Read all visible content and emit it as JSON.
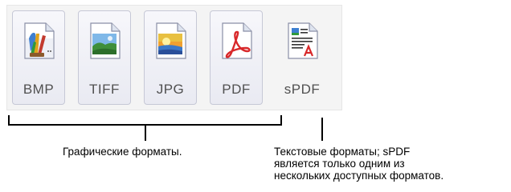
{
  "formats": [
    {
      "label": "BMP",
      "icon": "bmp-file-icon"
    },
    {
      "label": "TIFF",
      "icon": "tiff-file-icon"
    },
    {
      "label": "JPG",
      "icon": "jpg-file-icon"
    },
    {
      "label": "PDF",
      "icon": "pdf-file-icon"
    },
    {
      "label": "sPDF",
      "icon": "spdf-file-icon"
    }
  ],
  "captions": {
    "image_formats": "Графические форматы.",
    "text_formats_line1": "Текстовые форматы; sPDF",
    "text_formats_line2": "является только одним из",
    "text_formats_line3": "нескольких доступных форматов."
  },
  "colors": {
    "button_border": "#c6c8d6",
    "label_text": "#505050",
    "pdf_red": "#d8282a"
  }
}
